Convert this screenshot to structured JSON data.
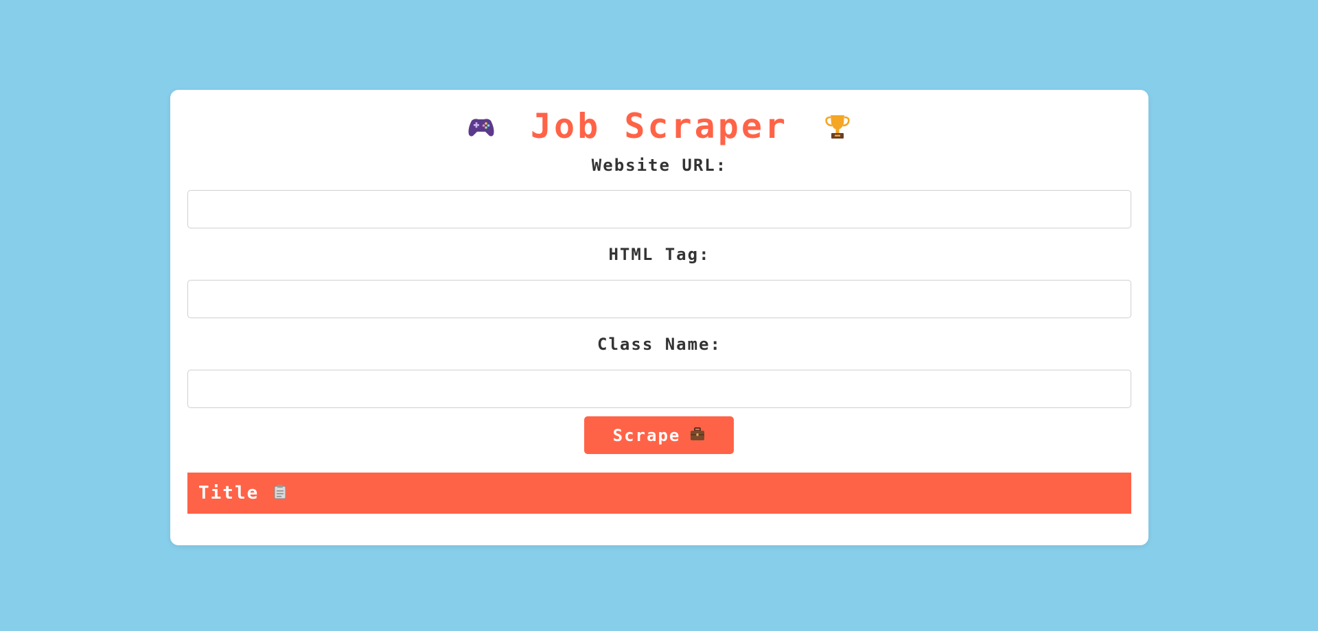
{
  "header": {
    "title": "Job Scraper",
    "left_icon": "game-controller-icon",
    "right_icon": "trophy-icon"
  },
  "form": {
    "url_label": "Website URL:",
    "url_value": "",
    "tag_label": "HTML Tag:",
    "tag_value": "",
    "class_label": "Class Name:",
    "class_value": ""
  },
  "actions": {
    "scrape_label": "Scrape",
    "scrape_icon": "briefcase-icon"
  },
  "results": {
    "columns": [
      "Title"
    ],
    "title_icon": "clipboard-icon"
  },
  "colors": {
    "background": "#87CEEB",
    "accent": "#FF6347",
    "text": "#333333"
  }
}
